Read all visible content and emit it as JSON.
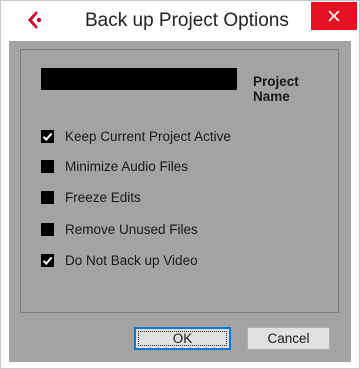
{
  "window": {
    "title": "Back up Project Options",
    "app_icon": "cubase-logo-icon",
    "close_icon": "close-icon",
    "accent": "#e81123"
  },
  "form": {
    "project_name_value": "",
    "project_name_label": "Project Name",
    "options": [
      {
        "label": "Keep Current Project Active",
        "checked": true
      },
      {
        "label": "Minimize Audio Files",
        "checked": false
      },
      {
        "label": "Freeze Edits",
        "checked": false
      },
      {
        "label": "Remove Unused Files",
        "checked": false
      },
      {
        "label": "Do Not Back up Video",
        "checked": true
      }
    ]
  },
  "buttons": {
    "ok_label": "OK",
    "cancel_label": "Cancel"
  },
  "colors": {
    "dialog_background": "#a3a3a3",
    "field_background": "#000000",
    "checkbox_background": "#000000"
  }
}
